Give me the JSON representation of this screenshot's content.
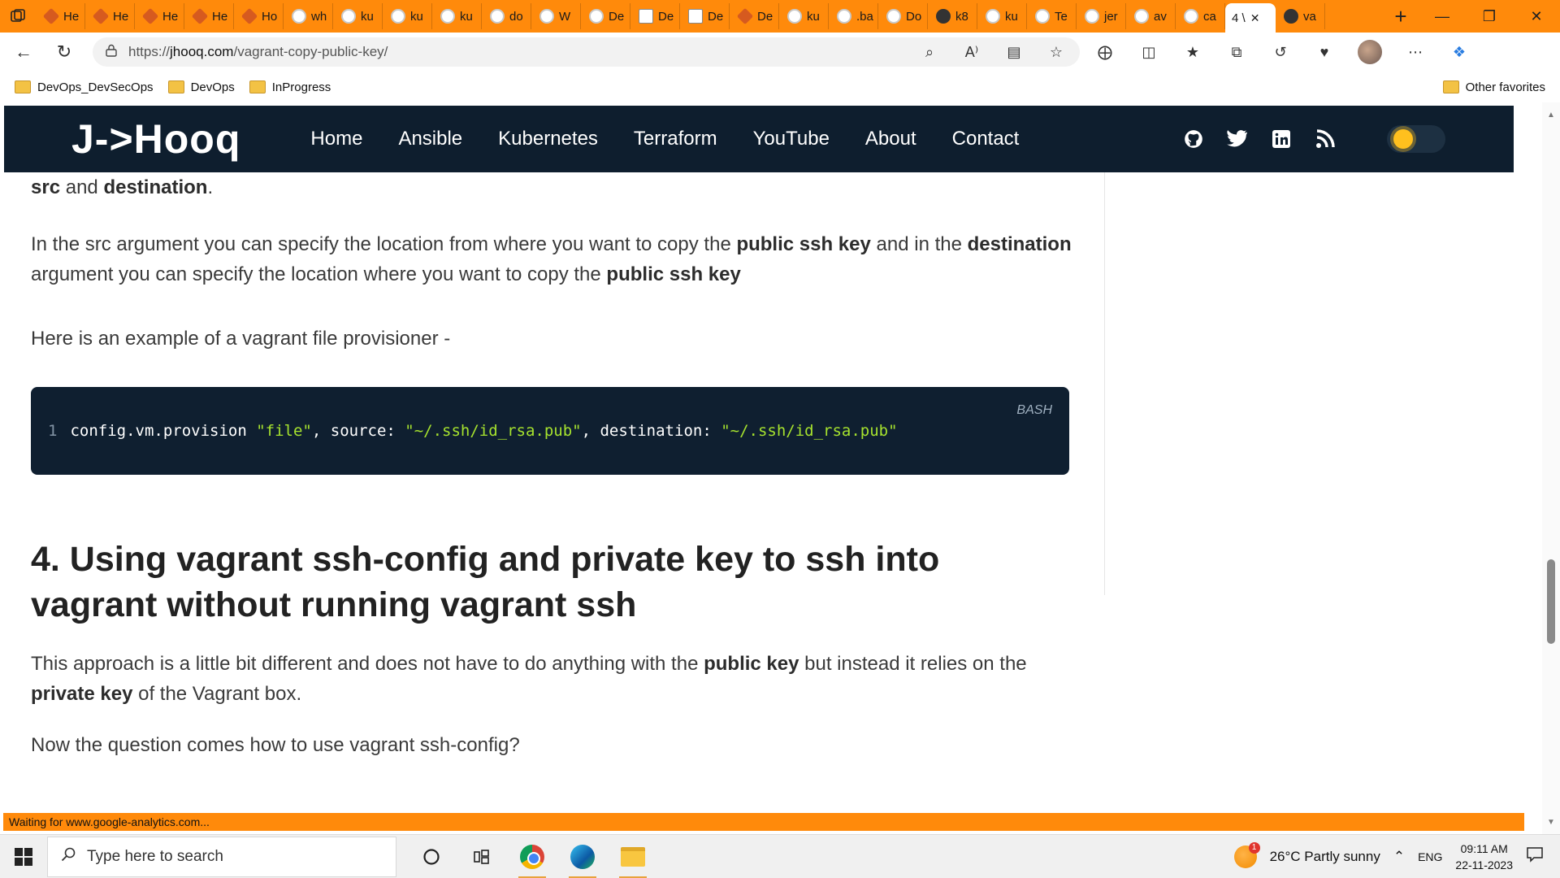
{
  "browser": {
    "tabs": [
      {
        "label": "He",
        "favicon": "hooked-icon"
      },
      {
        "label": "He",
        "favicon": "hooked-icon"
      },
      {
        "label": "He",
        "favicon": "hooked-icon"
      },
      {
        "label": "He",
        "favicon": "hooked-icon"
      },
      {
        "label": "Ho",
        "favicon": "hooked-icon"
      },
      {
        "label": "wh",
        "favicon": "google-icon"
      },
      {
        "label": "ku",
        "favicon": "google-icon"
      },
      {
        "label": "ku",
        "favicon": "google-icon"
      },
      {
        "label": "ku",
        "favicon": "google-icon"
      },
      {
        "label": "do",
        "favicon": "google-icon"
      },
      {
        "label": "W",
        "favicon": "bird-icon"
      },
      {
        "label": "De",
        "favicon": "google-icon"
      },
      {
        "label": "De",
        "favicon": "book-icon"
      },
      {
        "label": "De",
        "favicon": "doc-icon"
      },
      {
        "label": "De",
        "favicon": "shield-icon"
      },
      {
        "label": "ku",
        "favicon": "google-icon"
      },
      {
        "label": ".ba",
        "favicon": "google-icon"
      },
      {
        "label": "Do",
        "favicon": "bird-icon"
      },
      {
        "label": "k8",
        "favicon": "a-icon"
      },
      {
        "label": "ku",
        "favicon": "google-icon"
      },
      {
        "label": "Te",
        "favicon": "pin-icon"
      },
      {
        "label": "jer",
        "favicon": "google-icon"
      },
      {
        "label": "av",
        "favicon": "google-icon"
      },
      {
        "label": "ca",
        "favicon": "google-icon"
      },
      {
        "label": "4 \\",
        "favicon": "none",
        "active": true
      },
      {
        "label": "va",
        "favicon": "vagrant-icon"
      }
    ],
    "url_prefix": "https://",
    "url_domain": "jhooq.com",
    "url_path": "/vagrant-copy-public-key/",
    "favorites": [
      "DevOps_DevSecOps",
      "DevOps",
      "InProgress"
    ],
    "other_favorites": "Other favorites",
    "status_text": "Waiting for www.google-analytics.com...",
    "accent_color": "#ff8a0b"
  },
  "site": {
    "logo": "J->Hooq",
    "menu": [
      "Home",
      "Ansible",
      "Kubernetes",
      "Terraform",
      "YouTube",
      "About",
      "Contact"
    ],
    "social_icons": [
      "github-icon",
      "twitter-icon",
      "linkedin-icon",
      "rss-icon"
    ],
    "header_color": "#0e1e2e"
  },
  "article": {
    "p1_b1": "src",
    "p1_t1": " and ",
    "p1_b2": "destination",
    "p1_t2": ".",
    "p2_t1": "In the src argument you can specify the location from where you want to copy the ",
    "p2_b1": "public ssh key",
    "p2_t2": " and in the ",
    "p2_b2": "destination",
    "p2_t3": " argument you can specify the location where you want to copy the ",
    "p2_b3": "public ssh key",
    "p3": "Here is an example of a vagrant file provisioner -",
    "code": {
      "lang": "BASH",
      "line_no": "1",
      "seg1": "config.vm.provision ",
      "str1": "\"file\"",
      "seg2": ", source: ",
      "str2": "\"~/.ssh/id_rsa.pub\"",
      "seg3": ", destination: ",
      "str3": "\"~/.ssh/id_rsa.pub\""
    },
    "heading": "4. Using vagrant ssh-config and private key to ssh into vagrant without running vagrant ssh",
    "p4_t1": "This approach is a little bit different and does not have to do anything with the ",
    "p4_b1": "public key",
    "p4_t2": " but instead it relies on the ",
    "p4_b2": "private key",
    "p4_t3": " of the Vagrant box.",
    "p5": "Now the question comes how to use vagrant ssh-config?"
  },
  "taskbar": {
    "search_placeholder": "Type here to search",
    "weather_badge": "1",
    "weather": "26°C  Partly sunny",
    "lang": "ENG",
    "time": "09:11 AM",
    "date": "22-11-2023"
  }
}
